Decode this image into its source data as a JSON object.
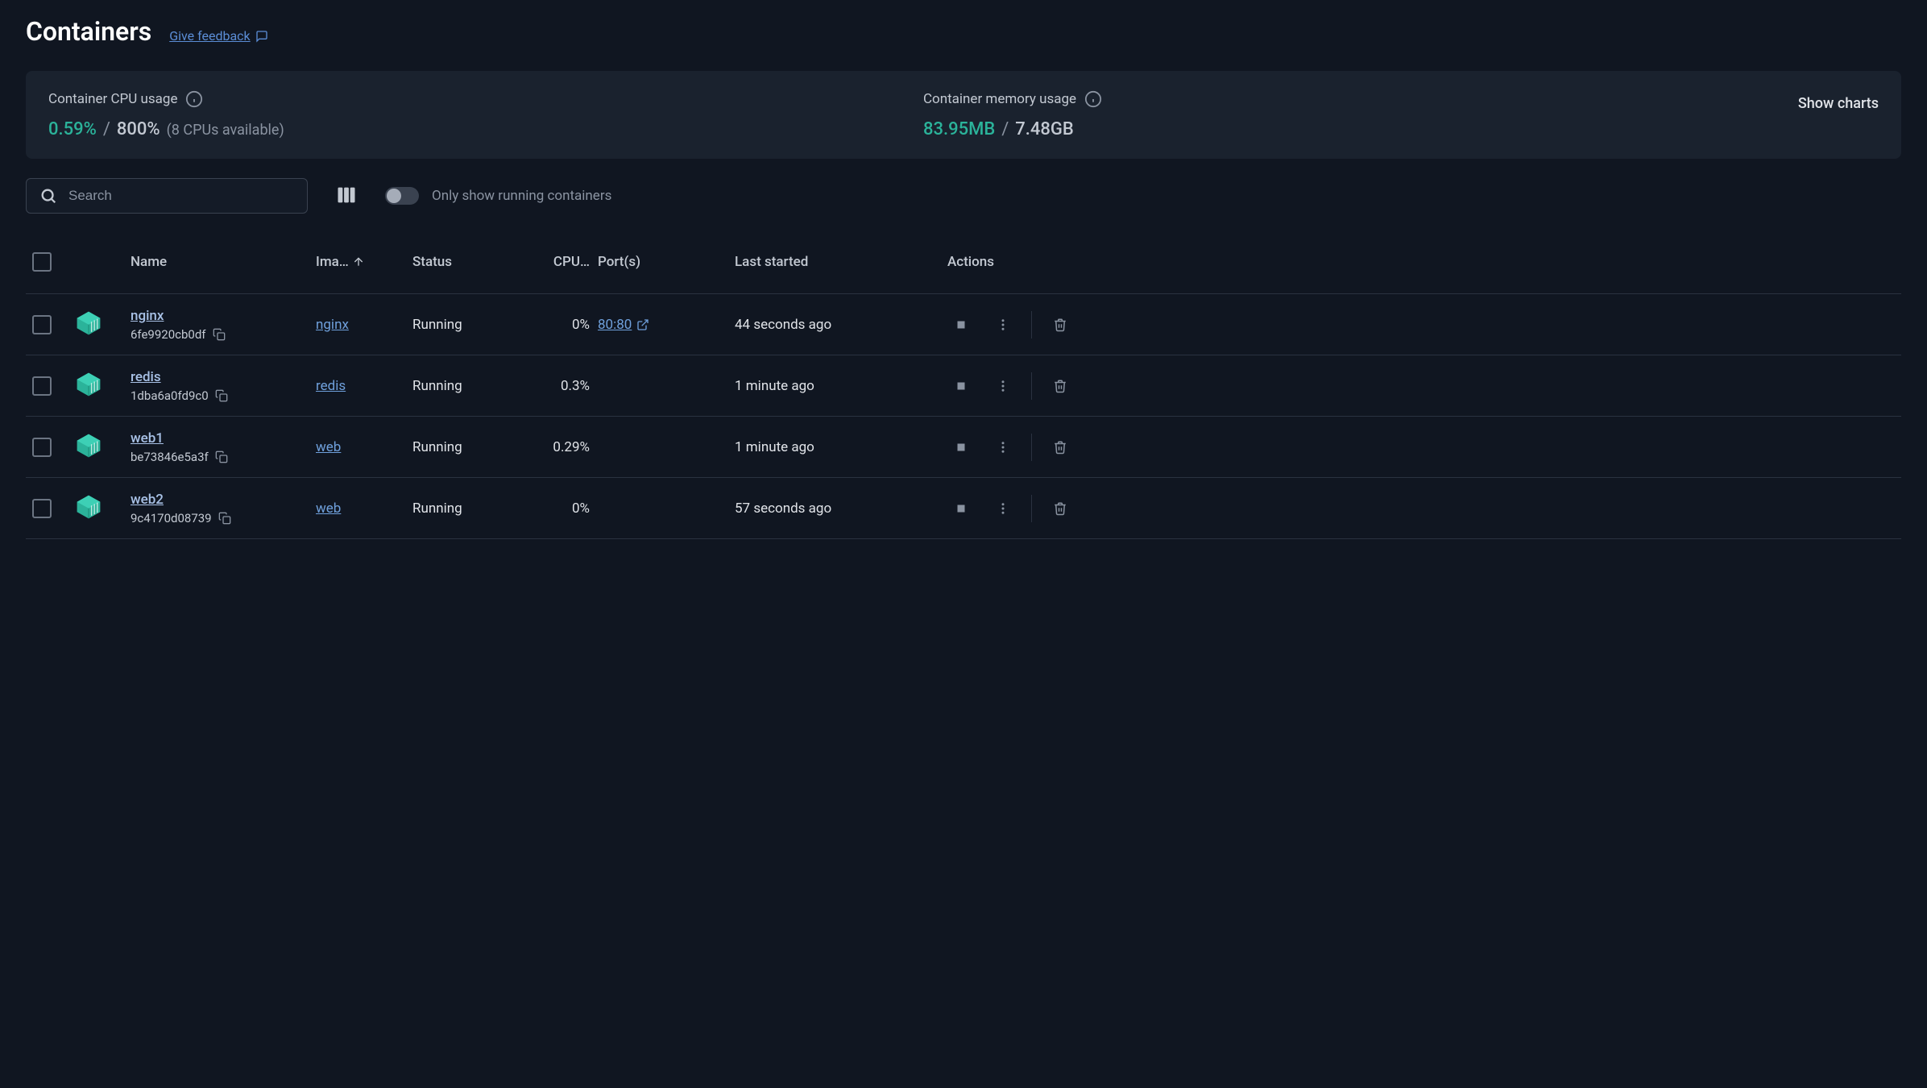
{
  "header": {
    "title": "Containers",
    "feedback_label": "Give feedback"
  },
  "stats": {
    "cpu": {
      "label": "Container CPU usage",
      "used": "0.59%",
      "sep": "/",
      "total": "800%",
      "extra": "(8 CPUs available)"
    },
    "memory": {
      "label": "Container memory usage",
      "used": "83.95MB",
      "sep": "/",
      "total": "7.48GB"
    },
    "show_charts_label": "Show charts"
  },
  "controls": {
    "search_placeholder": "Search",
    "toggle_label": "Only show running containers"
  },
  "table": {
    "headers": {
      "name": "Name",
      "image": "Ima…",
      "status": "Status",
      "cpu": "CPU…",
      "ports": "Port(s)",
      "last": "Last started",
      "actions": "Actions"
    },
    "rows": [
      {
        "name": "nginx",
        "id": "6fe9920cb0df",
        "image": "nginx",
        "status": "Running",
        "cpu": "0%",
        "port": "80:80",
        "last": "44 seconds ago"
      },
      {
        "name": "redis",
        "id": "1dba6a0fd9c0",
        "image": "redis",
        "status": "Running",
        "cpu": "0.3%",
        "port": "",
        "last": "1 minute ago"
      },
      {
        "name": "web1",
        "id": "be73846e5a3f",
        "image": "web",
        "status": "Running",
        "cpu": "0.29%",
        "port": "",
        "last": "1 minute ago"
      },
      {
        "name": "web2",
        "id": "9c4170d08739",
        "image": "web",
        "status": "Running",
        "cpu": "0%",
        "port": "",
        "last": "57 seconds ago"
      }
    ]
  }
}
